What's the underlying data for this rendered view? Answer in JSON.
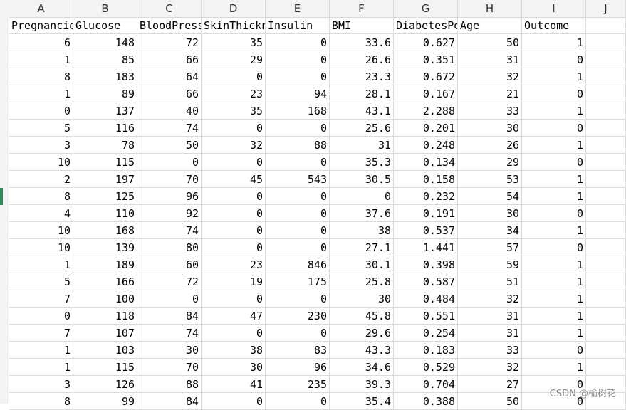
{
  "columns": [
    "A",
    "B",
    "C",
    "D",
    "E",
    "F",
    "G",
    "H",
    "I",
    "J"
  ],
  "headers": [
    "Pregnancies",
    "Glucose",
    "BloodPressure",
    "SkinThickness",
    "Insulin",
    "BMI",
    "DiabetesPedigreeFunction",
    "Age",
    "Outcome"
  ],
  "rows": [
    [
      "6",
      "148",
      "72",
      "35",
      "0",
      "33.6",
      "0.627",
      "50",
      "1"
    ],
    [
      "1",
      "85",
      "66",
      "29",
      "0",
      "26.6",
      "0.351",
      "31",
      "0"
    ],
    [
      "8",
      "183",
      "64",
      "0",
      "0",
      "23.3",
      "0.672",
      "32",
      "1"
    ],
    [
      "1",
      "89",
      "66",
      "23",
      "94",
      "28.1",
      "0.167",
      "21",
      "0"
    ],
    [
      "0",
      "137",
      "40",
      "35",
      "168",
      "43.1",
      "2.288",
      "33",
      "1"
    ],
    [
      "5",
      "116",
      "74",
      "0",
      "0",
      "25.6",
      "0.201",
      "30",
      "0"
    ],
    [
      "3",
      "78",
      "50",
      "32",
      "88",
      "31",
      "0.248",
      "26",
      "1"
    ],
    [
      "10",
      "115",
      "0",
      "0",
      "0",
      "35.3",
      "0.134",
      "29",
      "0"
    ],
    [
      "2",
      "197",
      "70",
      "45",
      "543",
      "30.5",
      "0.158",
      "53",
      "1"
    ],
    [
      "8",
      "125",
      "96",
      "0",
      "0",
      "0",
      "0.232",
      "54",
      "1"
    ],
    [
      "4",
      "110",
      "92",
      "0",
      "0",
      "37.6",
      "0.191",
      "30",
      "0"
    ],
    [
      "10",
      "168",
      "74",
      "0",
      "0",
      "38",
      "0.537",
      "34",
      "1"
    ],
    [
      "10",
      "139",
      "80",
      "0",
      "0",
      "27.1",
      "1.441",
      "57",
      "0"
    ],
    [
      "1",
      "189",
      "60",
      "23",
      "846",
      "30.1",
      "0.398",
      "59",
      "1"
    ],
    [
      "5",
      "166",
      "72",
      "19",
      "175",
      "25.8",
      "0.587",
      "51",
      "1"
    ],
    [
      "7",
      "100",
      "0",
      "0",
      "0",
      "30",
      "0.484",
      "32",
      "1"
    ],
    [
      "0",
      "118",
      "84",
      "47",
      "230",
      "45.8",
      "0.551",
      "31",
      "1"
    ],
    [
      "7",
      "107",
      "74",
      "0",
      "0",
      "29.6",
      "0.254",
      "31",
      "1"
    ],
    [
      "1",
      "103",
      "30",
      "38",
      "83",
      "43.3",
      "0.183",
      "33",
      "0"
    ],
    [
      "1",
      "115",
      "70",
      "30",
      "96",
      "34.6",
      "0.529",
      "32",
      "1"
    ],
    [
      "3",
      "126",
      "88",
      "41",
      "235",
      "39.3",
      "0.704",
      "27",
      "0"
    ],
    [
      "8",
      "99",
      "84",
      "0",
      "0",
      "35.4",
      "0.388",
      "50",
      "0"
    ]
  ],
  "watermark": "CSDN @榆树花",
  "colors": {
    "header_bg": "#f3f3f3",
    "grid_line": "#dcdcdc",
    "selected_row_marker": "#2e8b57"
  }
}
